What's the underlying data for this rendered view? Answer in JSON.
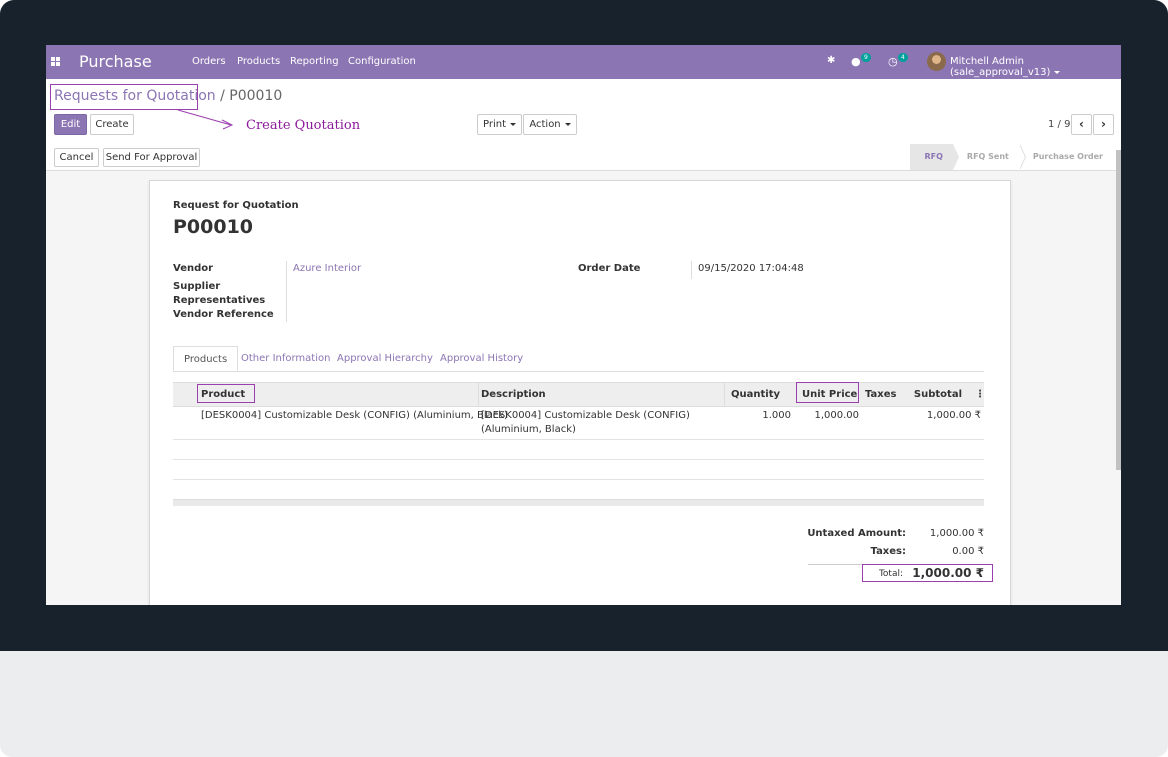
{
  "navbar": {
    "brand": "Purchase",
    "menu": [
      "Orders",
      "Products",
      "Reporting",
      "Configuration"
    ],
    "chat_count": "9",
    "activity_count": "4",
    "user": "Mitchell Admin (sale_approval_v13)"
  },
  "breadcrumb": {
    "parent": "Requests for Quotation",
    "separator": "/",
    "current": "P00010"
  },
  "buttons": {
    "edit": "Edit",
    "create": "Create",
    "print": "Print",
    "action": "Action",
    "cancel": "Cancel",
    "send_approval": "Send For Approval"
  },
  "pager": {
    "text": "1 / 9"
  },
  "stages": [
    "RFQ",
    "RFQ Sent",
    "Purchase Order"
  ],
  "annotation": "Create Quotation",
  "form": {
    "subtitle": "Request for Quotation",
    "title": "P00010",
    "vendor_label": "Vendor",
    "vendor_value": "Azure Interior",
    "supplier_label": "Supplier",
    "representatives_label": "Representatives",
    "vendor_ref_label": "Vendor Reference",
    "order_date_label": "Order Date",
    "order_date_value": "09/15/2020 17:04:48"
  },
  "tabs": [
    "Products",
    "Other Information",
    "Approval Hierarchy",
    "Approval History"
  ],
  "table": {
    "headers": {
      "product": "Product",
      "description": "Description",
      "quantity": "Quantity",
      "unit_price": "Unit Price",
      "taxes": "Taxes",
      "subtotal": "Subtotal"
    },
    "rows": [
      {
        "product": "[DESK0004] Customizable Desk (CONFIG) (Aluminium, Black)",
        "description_line1": "[DESK0004] Customizable Desk (CONFIG)",
        "description_line2": "(Aluminium, Black)",
        "quantity": "1.000",
        "unit_price": "1,000.00",
        "subtotal": "1,000.00 ₹"
      }
    ]
  },
  "totals": {
    "untaxed_label": "Untaxed Amount:",
    "untaxed_value": "1,000.00 ₹",
    "taxes_label": "Taxes:",
    "taxes_value": "0.00 ₹",
    "total_label": "Total:",
    "total_value": "1,000.00 ₹"
  },
  "colors": {
    "brand": "#8c75b3",
    "highlight": "#9b3fae",
    "monitor": "#17222d"
  }
}
